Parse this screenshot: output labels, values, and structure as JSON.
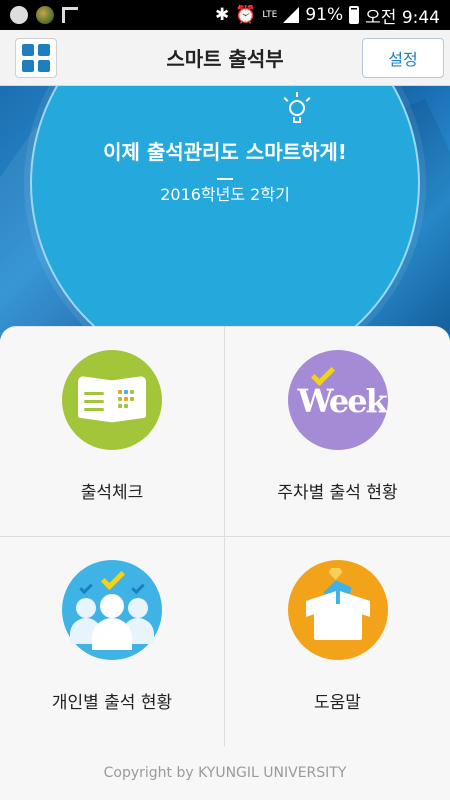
{
  "status_bar": {
    "network": "LTE",
    "battery": "91%",
    "time": "오전 9:44"
  },
  "header": {
    "title": "스마트 출석부",
    "settings_label": "설정",
    "menu_icon": "grid-menu-icon"
  },
  "banner": {
    "slogan": "이제 출석관리도 스마트하게!",
    "semester": "2016학년도 2학기"
  },
  "menu": {
    "items": [
      {
        "label": "출석체크",
        "icon": "open-book-icon",
        "color": "#a3c53a"
      },
      {
        "label": "주차별 출석 현황",
        "icon": "week-icon",
        "color": "#a58ad6",
        "icon_text": "Week"
      },
      {
        "label": "개인별 출석 현황",
        "icon": "people-check-icon",
        "color": "#3fb2e6"
      },
      {
        "label": "도움말",
        "icon": "help-box-icon",
        "color": "#f2a319"
      }
    ]
  },
  "footer": {
    "copyright": "Copyright by KYUNGIL UNIVERSITY"
  },
  "colors": {
    "accent": "#1d7fbf",
    "banner": "#25a9dc"
  }
}
